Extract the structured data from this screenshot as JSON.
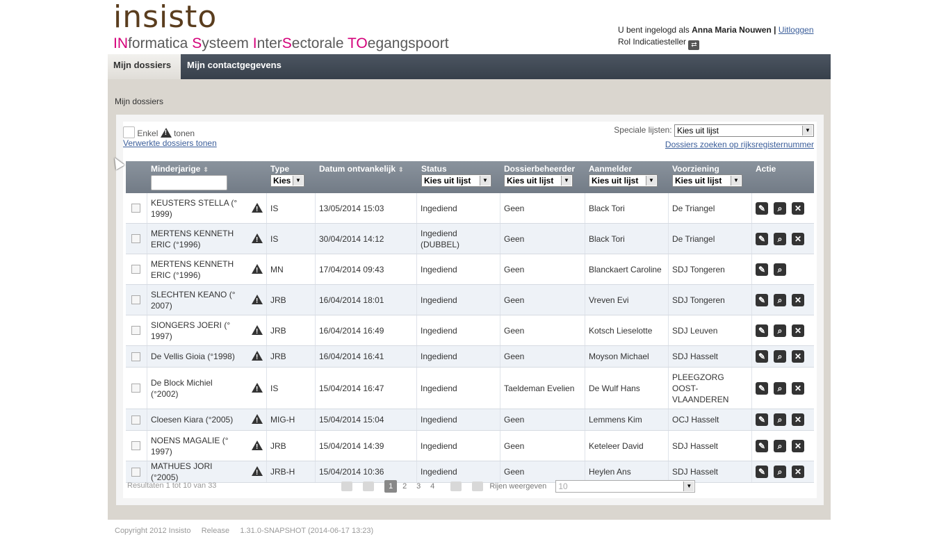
{
  "header": {
    "logo_text": "insisto",
    "tagline_parts": [
      {
        "text": "IN",
        "m": true
      },
      {
        "text": "formatica ",
        "m": false
      },
      {
        "text": "S",
        "m": true
      },
      {
        "text": "ysteem ",
        "m": false
      },
      {
        "text": "I",
        "m": true
      },
      {
        "text": "nter",
        "m": false
      },
      {
        "text": "S",
        "m": true
      },
      {
        "text": "ectorale  ",
        "m": false
      },
      {
        "text": "TO",
        "m": true
      },
      {
        "text": "egangspoort",
        "m": false
      }
    ],
    "logged_in_prefix": "U bent ingelogd als",
    "user_name": "Anna Maria Nouwen",
    "separator": "|",
    "logout_label": "Uitloggen",
    "role_label": "Rol Indicatiesteller",
    "role_icon": "switch-role-icon"
  },
  "nav": {
    "tabs": [
      {
        "label": "Mijn dossiers",
        "active": true
      },
      {
        "label": "Mijn contactgegevens",
        "active": false
      }
    ]
  },
  "breadcrumb": "Mijn dossiers",
  "filters": {
    "only_prefix": "Enkel",
    "only_suffix": "tonen",
    "processed_link": "Verwerkte dossiers tonen",
    "special_lists_label": "Speciale lijsten:",
    "special_lists_value": "Kies uit lijst",
    "search_rrn_link": "Dossiers zoeken op rijksregisternummer"
  },
  "table": {
    "headers": {
      "minor": "Minderjarige",
      "type": "Type",
      "type_filter": "Kies",
      "date": "Datum ontvankelijk",
      "status": "Status",
      "status_filter": "Kies uit lijst",
      "manager": "Dossierbeheerder",
      "manager_filter": "Kies uit lijst",
      "reporter": "Aanmelder",
      "reporter_filter": "Kies uit lijst",
      "provision": "Voorziening",
      "provision_filter": "Kies uit lijst",
      "action": "Actie"
    },
    "rows": [
      {
        "minor": "KEUSTERS STELLA (° 1999)",
        "type": "IS",
        "date": "13/05/2014 15:03",
        "status": "Ingediend",
        "manager": "Geen",
        "reporter": "Black Tori",
        "provision": "De Triangel",
        "delete": true
      },
      {
        "minor": "MERTENS KENNETH ERIC (°1996)",
        "type": "IS",
        "date": "30/04/2014 14:12",
        "status": "Ingediend (DUBBEL)",
        "manager": "Geen",
        "reporter": "Black Tori",
        "provision": "De Triangel",
        "delete": true
      },
      {
        "minor": "MERTENS KENNETH ERIC (°1996)",
        "type": "MN",
        "date": "17/04/2014 09:43",
        "status": "Ingediend",
        "manager": "Geen",
        "reporter": "Blanckaert Caroline",
        "provision": "SDJ Tongeren",
        "delete": false
      },
      {
        "minor": "SLECHTEN KEANO (° 2007)",
        "type": "JRB",
        "date": "16/04/2014 18:01",
        "status": "Ingediend",
        "manager": "Geen",
        "reporter": "Vreven Evi",
        "provision": "SDJ Tongeren",
        "delete": true
      },
      {
        "minor": "SIONGERS JOERI (° 1997)",
        "type": "JRB",
        "date": "16/04/2014 16:49",
        "status": "Ingediend",
        "manager": "Geen",
        "reporter": "Kotsch Lieselotte",
        "provision": "SDJ Leuven",
        "delete": true
      },
      {
        "minor": "De Vellis Gioia (°1998)",
        "type": "JRB",
        "date": "16/04/2014 16:41",
        "status": "Ingediend",
        "manager": "Geen",
        "reporter": "Moyson Michael",
        "provision": "SDJ Hasselt",
        "delete": true
      },
      {
        "minor": "De Block Michiel (°2002)",
        "type": "IS",
        "date": "15/04/2014 16:47",
        "status": "Ingediend",
        "manager": "Taeldeman Evelien",
        "reporter": "De Wulf Hans",
        "provision": "PLEEGZORG OOST-VLAANDEREN",
        "delete": true
      },
      {
        "minor": "Cloesen Kiara (°2005)",
        "type": "MIG-H",
        "date": "15/04/2014 15:04",
        "status": "Ingediend",
        "manager": "Geen",
        "reporter": "Lemmens Kim",
        "provision": "OCJ Hasselt",
        "delete": true
      },
      {
        "minor": "NOENS MAGALIE (° 1997)",
        "type": "JRB",
        "date": "15/04/2014 14:39",
        "status": "Ingediend",
        "manager": "Geen",
        "reporter": "Keteleer David",
        "provision": "SDJ Hasselt",
        "delete": true
      },
      {
        "minor": "MATHUES JORI (°2005)",
        "type": "JRB-H",
        "date": "15/04/2014 10:36",
        "status": "Ingediend",
        "manager": "Geen",
        "reporter": "Heylen Ans",
        "provision": "SDJ Hasselt",
        "delete": true
      }
    ]
  },
  "pager": {
    "results_text": "Resultaten 1 tot 10 van 33",
    "pages": [
      "1",
      "2",
      "3",
      "4"
    ],
    "current_page": "1",
    "rows_label": "Rijen weergeven",
    "rows_value": "10"
  },
  "footer": {
    "copyright": "Copyright 2012 Insisto",
    "release_label": "Release",
    "release_value": "1.31.0-SNAPSHOT (2014-06-17 13:23)"
  }
}
